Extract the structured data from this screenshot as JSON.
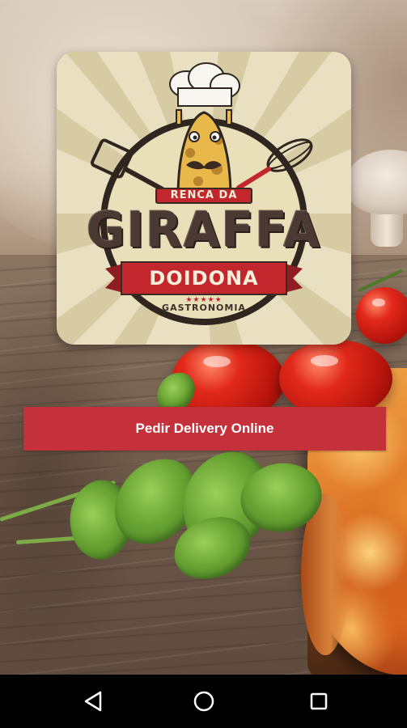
{
  "logo": {
    "top_label": "RENCA DA",
    "name": "GIRAFFA",
    "subtitle": "DOIDONA",
    "stars": "★★★★★",
    "tagline": "GASTRONOMIA"
  },
  "button": {
    "label": "Pedir Delivery Online",
    "color": "#c5313a"
  },
  "navbar": {
    "back_icon": "back-triangle-icon",
    "home_icon": "home-circle-icon",
    "recent_icon": "recent-apps-square-icon"
  }
}
